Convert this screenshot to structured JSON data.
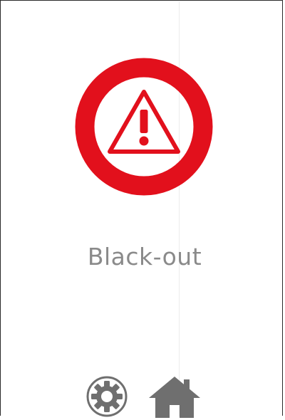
{
  "screen": {
    "status_text": "Black-out",
    "status_icon": "warning-triangle-icon",
    "colors": {
      "alarm_red": "#e2101c",
      "label_grey": "#8a8a8a",
      "icon_grey": "#6f6f6f",
      "background": "#ffffff"
    }
  },
  "footer": {
    "icons": [
      "gear-icon",
      "home-icon"
    ]
  }
}
